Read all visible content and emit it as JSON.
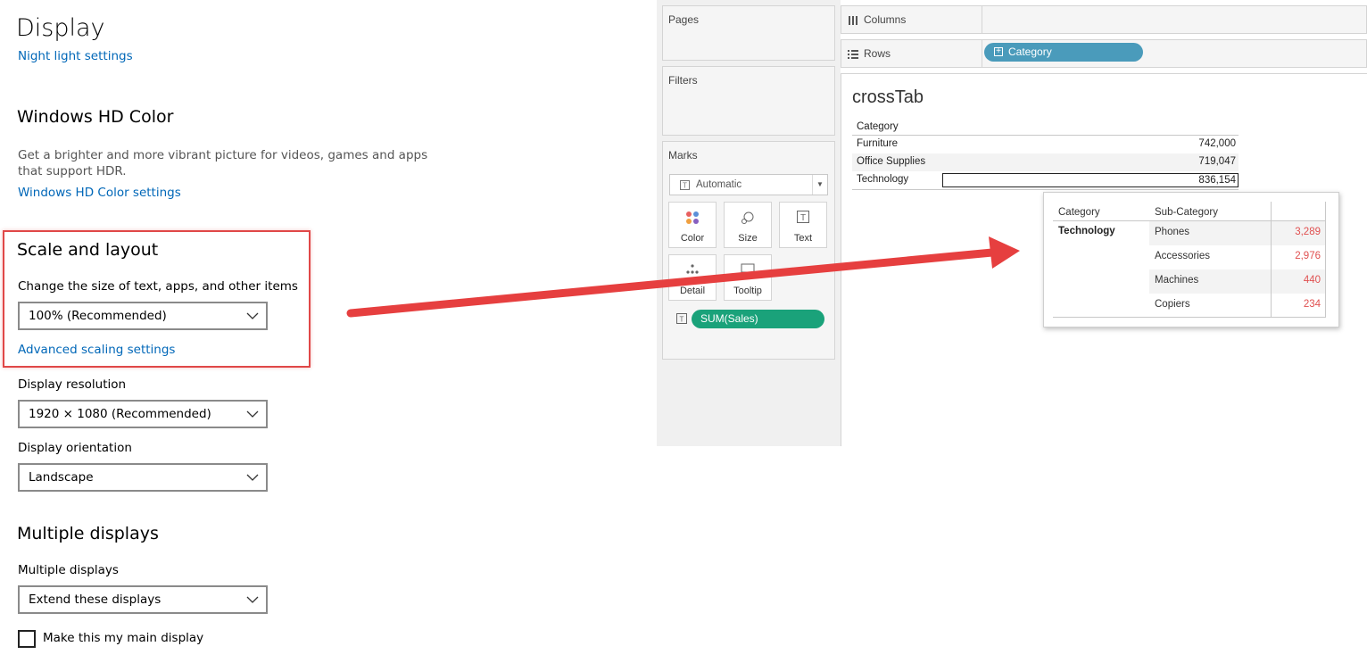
{
  "windows": {
    "title": "Display",
    "night_light_link": "Night light settings",
    "hd_color": {
      "heading": "Windows HD Color",
      "description": "Get a brighter and more vibrant picture for videos, games and apps that support HDR.",
      "link": "Windows HD Color settings"
    },
    "scale": {
      "heading": "Scale and layout",
      "label": "Change the size of text, apps, and other items",
      "value": "100% (Recommended)",
      "advanced_link": "Advanced scaling settings"
    },
    "resolution": {
      "label": "Display resolution",
      "value": "1920 × 1080 (Recommended)"
    },
    "orientation": {
      "label": "Display orientation",
      "value": "Landscape"
    },
    "multiple": {
      "heading": "Multiple displays",
      "label": "Multiple displays",
      "value": "Extend these displays",
      "main_checkbox_label": "Make this my main display",
      "main_checked": false
    },
    "highlight_color": "#e04848"
  },
  "tableau": {
    "cards": {
      "pages": "Pages",
      "filters": "Filters",
      "marks": "Marks"
    },
    "marks_type": "Automatic",
    "mark_buttons": {
      "color": "Color",
      "size": "Size",
      "text": "Text",
      "detail": "Detail",
      "tooltip": "Tooltip"
    },
    "sum_pill": "SUM(Sales)",
    "shelves": {
      "columns": "Columns",
      "rows": "Rows",
      "rows_pill": "Category"
    },
    "colors": {
      "dimension_pill": "#4a9bbb",
      "measure_pill": "#1aa27a",
      "value_red": "#e05050"
    },
    "view": {
      "title": "crossTab",
      "header": "Category",
      "rows": [
        {
          "category": "Furniture",
          "value": "742,000"
        },
        {
          "category": "Office Supplies",
          "value": "719,047"
        },
        {
          "category": "Technology",
          "value": "836,154"
        }
      ]
    },
    "popup": {
      "headers": {
        "category": "Category",
        "subcategory": "Sub-Category"
      },
      "category": "Technology",
      "rows": [
        {
          "sub": "Phones",
          "value": "3,289"
        },
        {
          "sub": "Accessories",
          "value": "2,976"
        },
        {
          "sub": "Machines",
          "value": "440"
        },
        {
          "sub": "Copiers",
          "value": "234"
        }
      ]
    }
  }
}
